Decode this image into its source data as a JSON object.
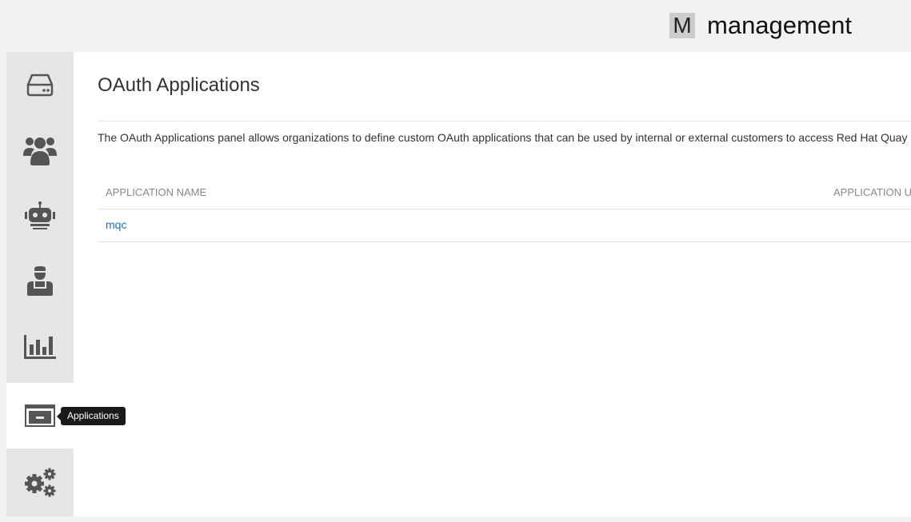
{
  "header": {
    "org_initial": "M",
    "org_name": "management"
  },
  "sidebar": {
    "items": [
      {
        "name": "repositories",
        "icon": "hard-drive-icon"
      },
      {
        "name": "teams",
        "icon": "users-icon"
      },
      {
        "name": "robot-accounts",
        "icon": "robot-icon"
      },
      {
        "name": "default-permissions",
        "icon": "user-tie-icon"
      },
      {
        "name": "usage-logs",
        "icon": "bar-chart-icon"
      },
      {
        "name": "applications",
        "icon": "window-icon",
        "active": true
      },
      {
        "name": "settings",
        "icon": "gears-icon"
      }
    ],
    "tooltip": "Applications"
  },
  "main": {
    "title": "OAuth Applications",
    "description": "The OAuth Applications panel allows organizations to define custom OAuth applications that can be used by internal or external customers to access Red Hat Quay data on behalf of the customers.",
    "table": {
      "columns": [
        "APPLICATION NAME",
        "APPLICATION URI"
      ],
      "rows": [
        {
          "name": "mqc",
          "uri": ""
        }
      ]
    }
  },
  "colors": {
    "link": "#1a73c4",
    "sidebar_bg": "#e6e6e6",
    "icon_color": "#555555",
    "tooltip_bg": "#1a1a1a"
  }
}
